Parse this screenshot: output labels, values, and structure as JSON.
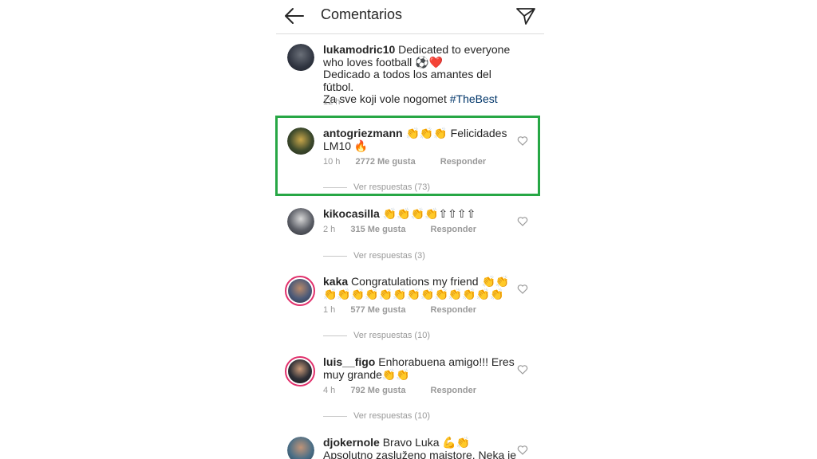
{
  "header": {
    "title": "Comentarios",
    "back_icon": "back-arrow-icon",
    "send_icon": "paper-plane-icon"
  },
  "caption": {
    "user": "lukamodric10",
    "line1": "Dedicated to everyone who loves football ⚽❤️",
    "line2": "Dedicado a todos los amantes del fútbol.",
    "line3": "Za sve koji vole nogomet ",
    "hashtag": "#TheBest",
    "time": "12 h"
  },
  "comments": [
    {
      "user": "antogriezmann",
      "text": "👏👏👏 Felicidades LM10 🔥",
      "time": "10 h",
      "likes": "2772 Me gusta",
      "reply": "Responder",
      "view_replies": "Ver respuestas (73)"
    },
    {
      "user": "kikocasilla",
      "text": "👏👏👏👏⇧⇧⇧⇧",
      "time": "2 h",
      "likes": "315 Me gusta",
      "reply": "Responder",
      "view_replies": "Ver respuestas (3)"
    },
    {
      "user": "kaka",
      "text": "Congratulations my friend 👏👏👏👏👏👏👏👏👏👏👏👏👏👏👏",
      "time": "1 h",
      "likes": "577 Me gusta",
      "reply": "Responder",
      "view_replies": "Ver respuestas (10)"
    },
    {
      "user": "luis__figo",
      "text": "Enhorabuena amigo!!! Eres muy grande👏👏",
      "time": "4 h",
      "likes": "792 Me gusta",
      "reply": "Responder",
      "view_replies": "Ver respuestas (10)"
    },
    {
      "user": "djokernole",
      "text": "Bravo Luka 💪👏 Apsolutno zasluženo majstore. Neka je sa"
    }
  ],
  "colors": {
    "highlight": "#27a745",
    "story_ring": "#e1306c",
    "hashtag": "#003569",
    "muted": "#999999"
  }
}
